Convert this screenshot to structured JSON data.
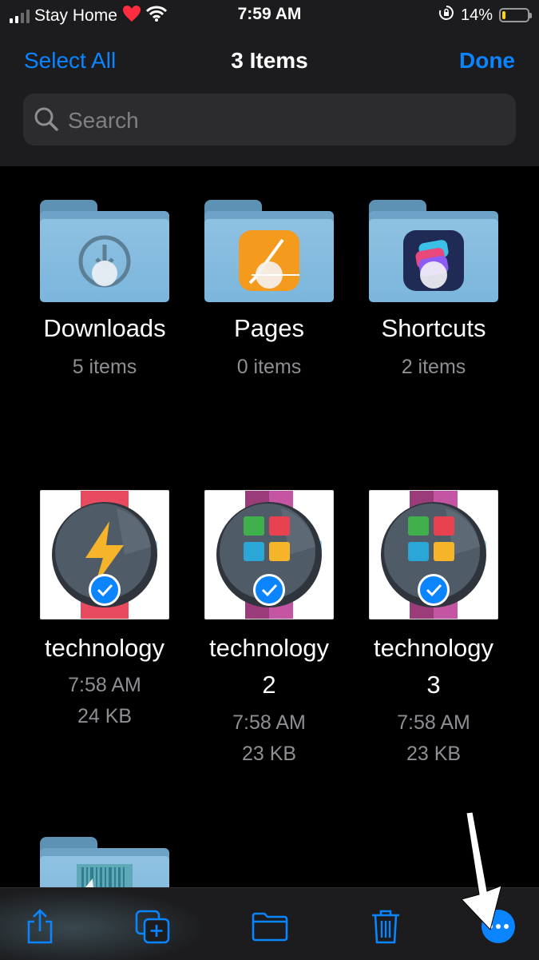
{
  "status_bar": {
    "carrier": "Stay Home",
    "time": "7:59 AM",
    "battery_percent": "14%",
    "battery_level": 0.14,
    "signal_bars_active": 2,
    "signal_bars_total": 4,
    "carrier_emoji": "heart-icon",
    "wifi": "wifi-icon",
    "orientation_lock": "orientation-lock-icon"
  },
  "header": {
    "select_all_label": "Select All",
    "title": "3 Items",
    "done_label": "Done"
  },
  "search": {
    "placeholder": "Search",
    "value": ""
  },
  "folders": [
    {
      "name": "Downloads",
      "count": "5 items",
      "icon": "download-badge-icon"
    },
    {
      "name": "Pages",
      "count": "0 items",
      "icon": "pages-app-icon"
    },
    {
      "name": "Shortcuts",
      "count": "2 items",
      "icon": "shortcuts-app-icon"
    }
  ],
  "files": [
    {
      "name_line1": "technology",
      "name_line2": "",
      "time": "7:58 AM",
      "size": "24 KB",
      "selected": true,
      "thumbnail": "smartwatch-lightning-icon"
    },
    {
      "name_line1": "technology",
      "name_line2": "2",
      "time": "7:58 AM",
      "size": "23 KB",
      "selected": true,
      "thumbnail": "smartwatch-apps-icon"
    },
    {
      "name_line1": "technology",
      "name_line2": "3",
      "time": "7:58 AM",
      "size": "23 KB",
      "selected": true,
      "thumbnail": "smartwatch-apps-icon"
    }
  ],
  "partial_folder": {
    "icon": "barcode-folder-icon"
  },
  "toolbar": {
    "buttons": [
      "share-icon",
      "duplicate-icon",
      "move-folder-icon",
      "trash-icon",
      "more-icon"
    ]
  },
  "colors": {
    "accent": "#0a84ff",
    "background": "#000000",
    "bar_background": "#1c1c1e",
    "secondary_text": "#8e8e93",
    "folder": "#7bb6dc"
  }
}
